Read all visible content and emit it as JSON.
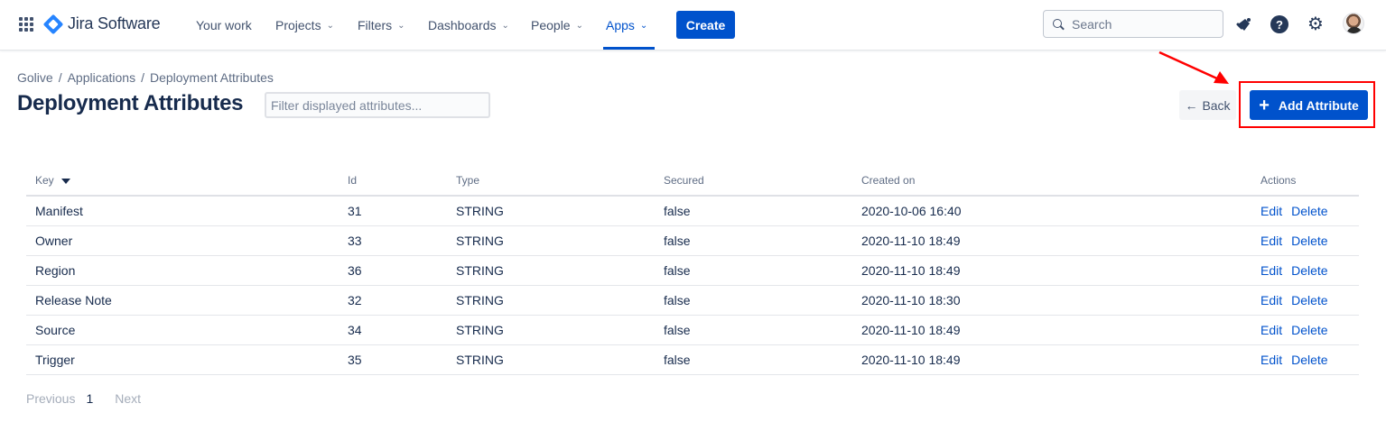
{
  "nav": {
    "logo_text": "Jira Software",
    "items": [
      {
        "label": "Your work"
      },
      {
        "label": "Projects",
        "chevron": "⌄"
      },
      {
        "label": "Filters",
        "chevron": "⌄"
      },
      {
        "label": "Dashboards",
        "chevron": "⌄"
      },
      {
        "label": "People",
        "chevron": "⌄"
      },
      {
        "label": "Apps",
        "chevron": "⌄"
      }
    ],
    "create_label": "Create",
    "search_placeholder": "Search",
    "icons": [
      "notifications-icon",
      "help-icon",
      "settings-icon",
      "avatar"
    ],
    "help_glyph": "?",
    "gear_glyph": "⚙"
  },
  "breadcrumb": [
    "Golive",
    "Applications",
    "Deployment Attributes"
  ],
  "breadcrumb_sep": "/",
  "page_title": "Deployment Attributes",
  "filter_placeholder": "Filter displayed attributes...",
  "back_label": "Back",
  "back_arrow": "←",
  "add_label": "Add Attribute",
  "add_glyph": "+",
  "table": {
    "headers": [
      "Key",
      "Id",
      "Type",
      "Secured",
      "Created on",
      "Actions"
    ],
    "rows": [
      {
        "key": "Manifest",
        "id": "31",
        "type": "STRING",
        "secured": "false",
        "created": "2020-10-06 16:40"
      },
      {
        "key": "Owner",
        "id": "33",
        "type": "STRING",
        "secured": "false",
        "created": "2020-11-10 18:49"
      },
      {
        "key": "Region",
        "id": "36",
        "type": "STRING",
        "secured": "false",
        "created": "2020-11-10 18:49"
      },
      {
        "key": "Release Note",
        "id": "32",
        "type": "STRING",
        "secured": "false",
        "created": "2020-11-10 18:30"
      },
      {
        "key": "Source",
        "id": "34",
        "type": "STRING",
        "secured": "false",
        "created": "2020-11-10 18:49"
      },
      {
        "key": "Trigger",
        "id": "35",
        "type": "STRING",
        "secured": "false",
        "created": "2020-11-10 18:49"
      }
    ],
    "edit_label": "Edit",
    "delete_label": "Delete"
  },
  "pagination": {
    "previous": "Previous",
    "page": "1",
    "next": "Next"
  },
  "colors": {
    "accent": "#0052cc",
    "annotation": "#ff0000"
  }
}
